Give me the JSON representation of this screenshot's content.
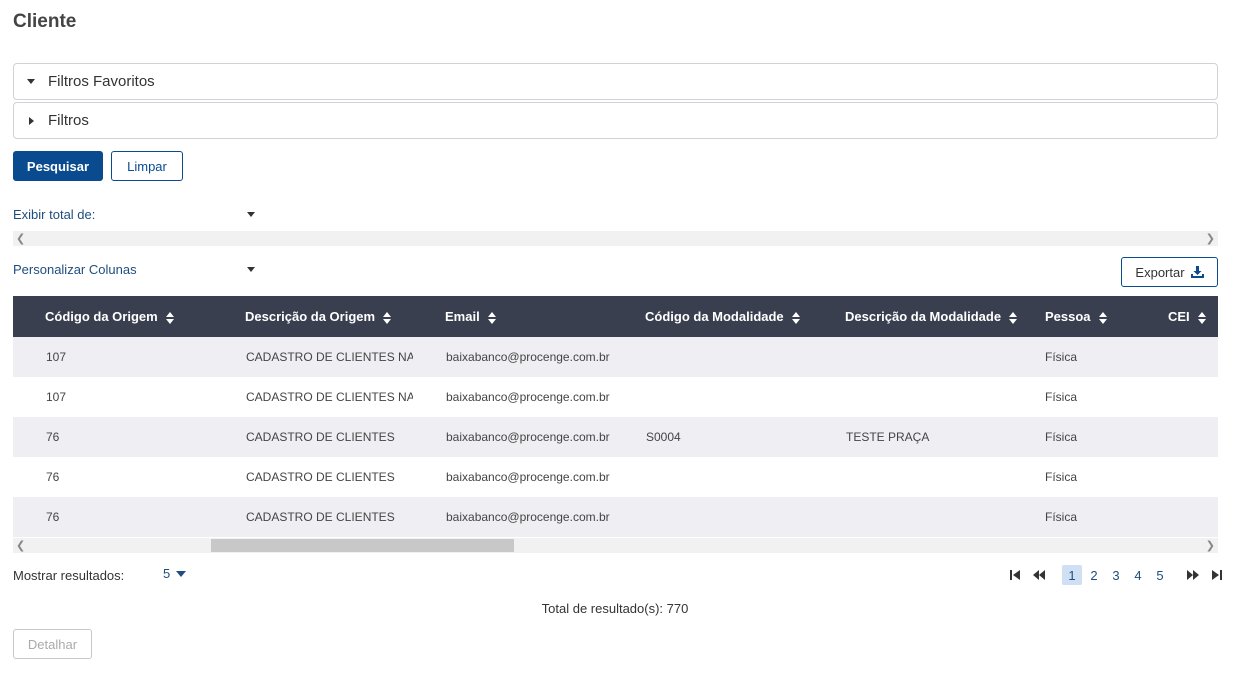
{
  "page": {
    "title": "Cliente"
  },
  "filters": {
    "favorites_label": "Filtros Favoritos",
    "filters_label": "Filtros"
  },
  "actions": {
    "search_label": "Pesquisar",
    "clear_label": "Limpar"
  },
  "display_total": {
    "label": "Exibir total de:"
  },
  "customize_columns": {
    "label": "Personalizar Colunas"
  },
  "export": {
    "label": "Exportar",
    "icon": "download-icon"
  },
  "table": {
    "columns": [
      "Código da Origem",
      "Descrição da Origem",
      "Email",
      "Código da Modalidade",
      "Descrição da Modalidade",
      "Pessoa",
      "CEI"
    ],
    "rows": [
      [
        "107",
        "CADASTRO DE CLIENTES NA WEB",
        "baixabanco@procenge.com.br",
        "",
        "",
        "Física",
        ""
      ],
      [
        "107",
        "CADASTRO DE CLIENTES NA WEB",
        "baixabanco@procenge.com.br",
        "",
        "",
        "Física",
        ""
      ],
      [
        "76",
        "CADASTRO DE CLIENTES",
        "baixabanco@procenge.com.br",
        "S0004",
        "TESTE PRAÇA",
        "Física",
        ""
      ],
      [
        "76",
        "CADASTRO DE CLIENTES",
        "baixabanco@procenge.com.br",
        "",
        "",
        "Física",
        ""
      ],
      [
        "76",
        "CADASTRO DE CLIENTES",
        "baixabanco@procenge.com.br",
        "",
        "",
        "Física",
        ""
      ]
    ]
  },
  "pagination": {
    "show_results_label": "Mostrar resultados:",
    "page_size": "5",
    "pages": [
      "1",
      "2",
      "3",
      "4",
      "5"
    ],
    "current_page": "1",
    "total_text": "Total de resultado(s): 770"
  },
  "detail": {
    "label": "Detalhar"
  },
  "colors": {
    "primary": "#0a4b8f",
    "header_bg": "#3a3f4f",
    "row_alt": "#efeff3",
    "link": "#1f4e7e"
  }
}
